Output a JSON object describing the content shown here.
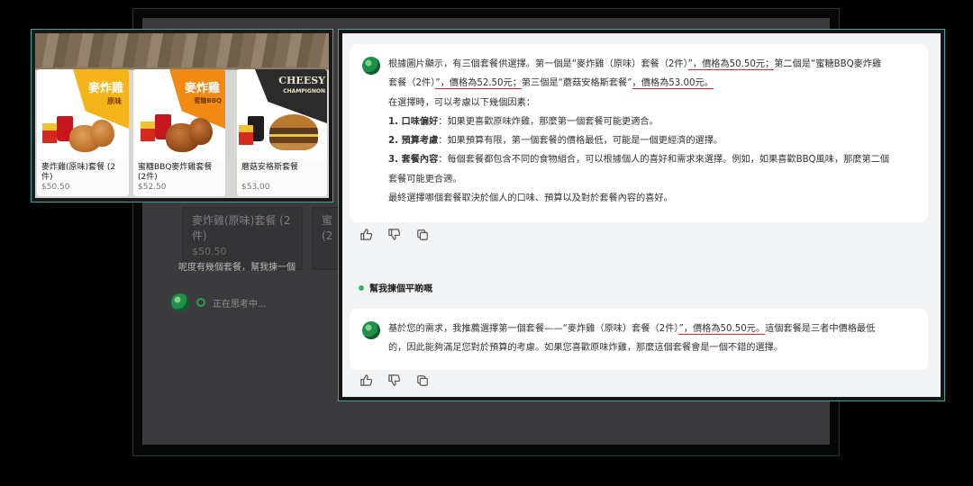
{
  "background_window": {
    "cards": [
      {
        "title": "麥炸雞(原味)套餐 (2\n件)",
        "price": "$50.50"
      },
      {
        "title": "蜜\n(2",
        "price": ""
      }
    ],
    "user_message": "呢度有幾個套餐，幫我揀一個",
    "thinking_text": "正在思考中..."
  },
  "menu": {
    "items": [
      {
        "name": "麥炸雞(原味)套餐 (2\n件)",
        "price": "$50.50",
        "banner": "麥炸雞",
        "banner_sub": "原味"
      },
      {
        "name": "蜜糖BBQ麥炸雞套餐\n(2件)",
        "price": "$52.50",
        "banner": "麥炸雞",
        "banner_sub": "蜜糖BBQ"
      },
      {
        "name": "蘑菇安格斯套餐",
        "price": "$53.00",
        "banner": "CHEESY",
        "banner_sub": "CHAMPIGNON"
      }
    ]
  },
  "chat": {
    "reply1": {
      "line1_a": "根據圖片顯示，有三個套餐供選擇。第一個是“麥炸雞（原味）套餐（2件）",
      "line1_u1": "”，價格為50.50元；",
      "line1_b": "第二個是“蜜糖BBQ麥炸雞",
      "line2_a": "套餐（2件）",
      "line2_u1": "”，價格為52.50元；",
      "line2_b": "第三個是“蘑菇安格斯套餐”",
      "line2_u2": "，價格為53.00元。",
      "intro": "在選擇時，可以考慮以下幾個因素：",
      "f1_label": "1. 口味偏好",
      "f1_text": "：如果更喜歡原味炸雞，那麼第一個套餐可能更適合。",
      "f2_label": "2. 預算考慮",
      "f2_text": "：如果預算有限，第一個套餐的價格最低，可能是一個更經濟的選擇。",
      "f3_label": "3. 套餐內容",
      "f3_text": "：每個套餐都包含不同的食物組合，可以根據個人的喜好和需求來選擇。例如，如果喜歡BBQ風味，那麼第二個",
      "f3_text2": "套餐可能更合適。",
      "conclusion": "最終選擇哪個套餐取決於個人的口味、預算以及對於套餐內容的喜好。"
    },
    "user_question": "幫我揀個平啲嘅",
    "reply2": {
      "line1_a": "基於您的需求，我推薦選擇第一個套餐——“麥炸雞（原味）套餐（2件）",
      "line1_u": "”，價格為50.50元。",
      "line1_b": "這個套餐是三者中價格最低",
      "line2": "的，因此能夠滿足您對於預算的考慮。如果您喜歡原味炸雞，那麼這個套餐會是一個不錯的選擇。"
    },
    "actions": [
      "thumbs-up",
      "thumbs-down",
      "copy"
    ]
  },
  "colors": {
    "underline": "#e0262b",
    "frame": "#3fa79a",
    "accent_green": "#1f8f4a",
    "banner_yellow": "#f4b41a"
  }
}
